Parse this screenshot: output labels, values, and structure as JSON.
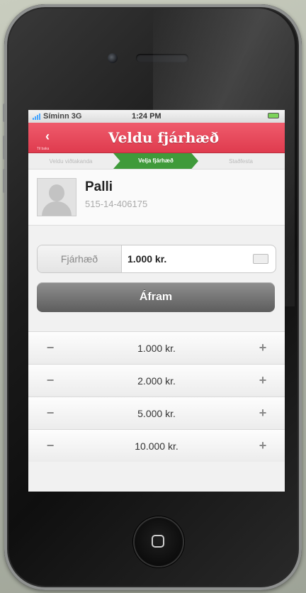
{
  "status_bar": {
    "carrier": "Síminn 3G",
    "time": "1:24 PM"
  },
  "nav": {
    "title": "Veldu fjárhæð",
    "back_icon": "chevron-left-icon",
    "back_sub": "Til baka"
  },
  "steps": [
    {
      "label": "Veldu viðtakanda",
      "active": false
    },
    {
      "label": "Velja fjárhæð",
      "active": true
    },
    {
      "label": "Staðfesta",
      "active": false
    }
  ],
  "contact": {
    "name": "Palli",
    "number": "515-14-406175"
  },
  "amount_field": {
    "label": "Fjárhæð",
    "value": "1.000 kr."
  },
  "continue_button": {
    "label": "Áfram"
  },
  "amounts": [
    {
      "label": "1.000 kr."
    },
    {
      "label": "2.000 kr."
    },
    {
      "label": "5.000 kr."
    },
    {
      "label": "10.000 kr."
    }
  ],
  "colors": {
    "nav_red": "#e3485a",
    "step_green": "#3f9a3a",
    "button_gray": "#6e6e6e"
  }
}
